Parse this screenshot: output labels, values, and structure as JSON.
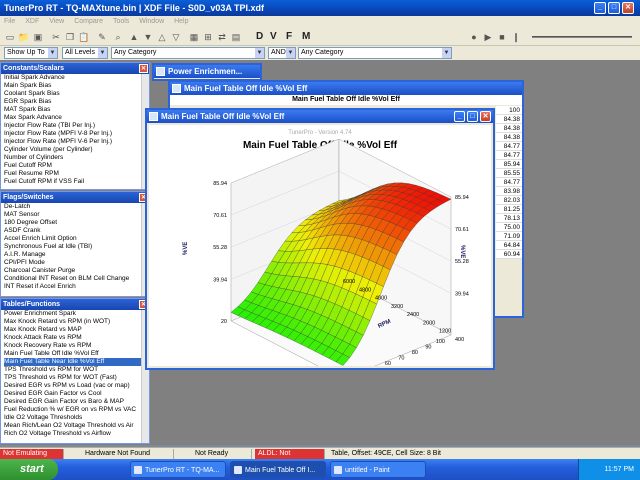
{
  "app": {
    "title": "TunerPro RT - TQ-MAXtune.bin | XDF File - S0D_v03A TPI.xdf"
  },
  "menu": [
    "File",
    "XDF",
    "View",
    "Compare",
    "Tools",
    "Window",
    "Help"
  ],
  "toolbar_letters": [
    "D",
    "V",
    "F",
    "M"
  ],
  "filters": {
    "show": "Show Up To",
    "levels": "All Levels",
    "category1": "Any Category",
    "logic": "AND",
    "category2": "Any Category"
  },
  "panels": {
    "constants": {
      "title": "Constants/Scalars",
      "items": [
        "Initial Spark Advance",
        "Main Spark Bias",
        "Coolant Spark Bias",
        "EGR Spark Bias",
        "MAT Spark Bias",
        "Max Spark Advance",
        "Injector Flow Rate (TBI Per Inj.)",
        "Injector Flow Rate (MPFI V-8 Per Inj.)",
        "Injector Flow Rate (MPFI V-6 Per Inj.)",
        "Cylinder Volume (per Cylinder)",
        "Number of Cylinders",
        "Fuel Cutoff RPM",
        "Fuel Resume RPM",
        "Fuel Cutoff RPM if VSS Fail"
      ]
    },
    "flags": {
      "title": "Flags/Switches",
      "items": [
        "De-Latch",
        "MAT Sensor",
        "180 Degree Offset",
        "ASDF Crank",
        "Accel Enrich Limit Option",
        "Synchronous Fuel at Idle (TBI)",
        "A.I.R. Manage",
        "CPI/PFI Mode",
        "Charcoal Canister Purge",
        "Conditional INT Reset on BLM Cell Change",
        "INT Reset if Accel Enrich"
      ]
    },
    "tables": {
      "title": "Tables/Functions",
      "selected_index": 6,
      "items": [
        "Power Enrichment Spark",
        "Max Knock Retard vs RPM (in WOT)",
        "Max Knock Retard vs MAP",
        "Knock Attack Rate vs RPM",
        "Knock Recovery Rate vs RPM",
        "Main Fuel Table Off Idle %Vol Eff",
        "Main Fuel Table Near Idle %Vol Eff",
        "TPS Threshold vs RPM for WOT",
        "TPS Threshold vs RPM for WOT (Fast)",
        "Desired EGR vs RPM vs Load (vac or map)",
        "Desired EGR Gain Factor vs Cool",
        "Desired EGR Gain Factor vs Baro & MAP",
        "Fuel Reduction % w/ EGR on vs RPM vs VAC",
        "Idle O2 Voltage Thresholds",
        "Mean Rich/Lean O2 Voltage Threshold vs Air",
        "Rich O2 Voltage Threshold vs Airflow"
      ]
    }
  },
  "windows": {
    "power": "Power Enrichmen...",
    "grid_title": "Main Fuel Table Off Idle %Vol Eff",
    "grid_header": "Main Fuel Table Off Idle %Vol Eff",
    "grid_values": [
      "100",
      "84.38",
      "84.38",
      "84.38",
      "84.77",
      "84.77",
      "85.94",
      "85.55",
      "84.77",
      "83.98",
      "82.03",
      "81.25",
      "78.13",
      "75.00",
      "71.09",
      "64.84",
      "60.94"
    ],
    "chart_title": "Main Fuel Table Off Idle %Vol Eff"
  },
  "chart_data": {
    "type": "surface",
    "title": "Main Fuel Table Off Idle %Vol Eff",
    "watermark": "TunerPro - Version 4.74",
    "xlabel": "MAP kPa",
    "ylabel": "RPM",
    "zlabel": "%VE",
    "map_ticks": [
      "20",
      "30",
      "40",
      "50",
      "60",
      "70",
      "80",
      "90",
      "100"
    ],
    "rpm_ticks": [
      "400",
      "1200",
      "2000",
      "2400",
      "3200",
      "4000",
      "4800",
      "6000"
    ],
    "z_ticks": [
      "20",
      "39.94",
      "55.28",
      "70.61",
      "85.94"
    ],
    "zlim": [
      20,
      85.94
    ]
  },
  "status": {
    "emulating": "Not Emulating",
    "hardware": "Hardware Not Found",
    "ready": "Not Ready",
    "aldl": "ALDL: Not Connected",
    "info": "Table, Offset: 49CE,  Cell Size: 8 Bit"
  },
  "taskbar": {
    "start": "start",
    "tasks": [
      "TunerPro RT - TQ-MA...",
      "Main Fuel Table Off I...",
      "untitled - Paint"
    ],
    "time": "11:57 PM"
  }
}
